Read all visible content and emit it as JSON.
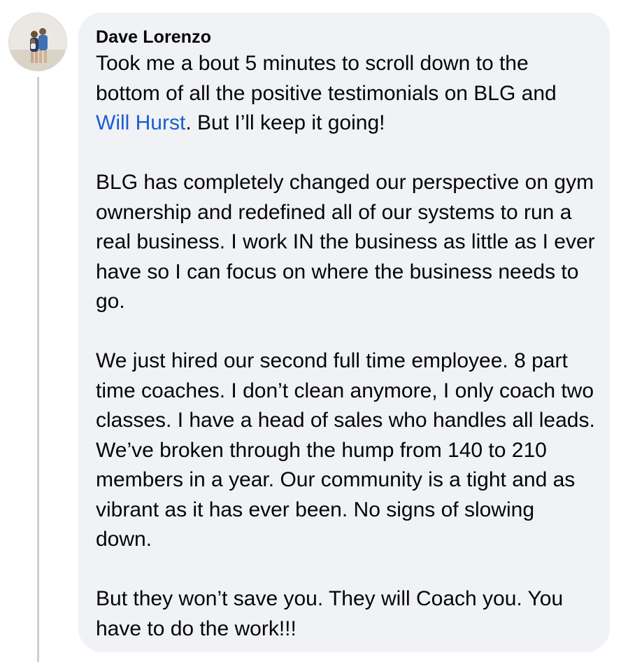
{
  "comment": {
    "author": "Dave Lorenzo",
    "paragraphs": [
      {
        "before_mention": "Took me a bout 5 minutes to scroll down to the bottom of all the positive testimonials on BLG and ",
        "mention": "Will Hurst",
        "after_mention": ". But I’ll keep it going!"
      },
      {
        "text": "BLG has completely changed our perspective on gym ownership and redefined all of our systems to run a real business. I work IN the business as little as I ever have so I can focus on where the business needs to go."
      },
      {
        "text": "We just hired our second full time employee. 8 part time coaches. I don’t clean anymore, I only coach two classes. I have a head of sales who handles all leads. We’ve broken through the hump from 140 to 210 members in a year. Our community is a tight and as vibrant as it has ever been. No signs of slowing down."
      },
      {
        "text": "But they won’t save you. They will Coach you. You have to do the work!!!"
      }
    ]
  },
  "colors": {
    "bubble_bg": "#f0f2f5",
    "mention": "#1b5fd1",
    "text": "#050505",
    "thread_line": "#ced0d4"
  },
  "icons": {
    "avatar": "profile-photo"
  }
}
